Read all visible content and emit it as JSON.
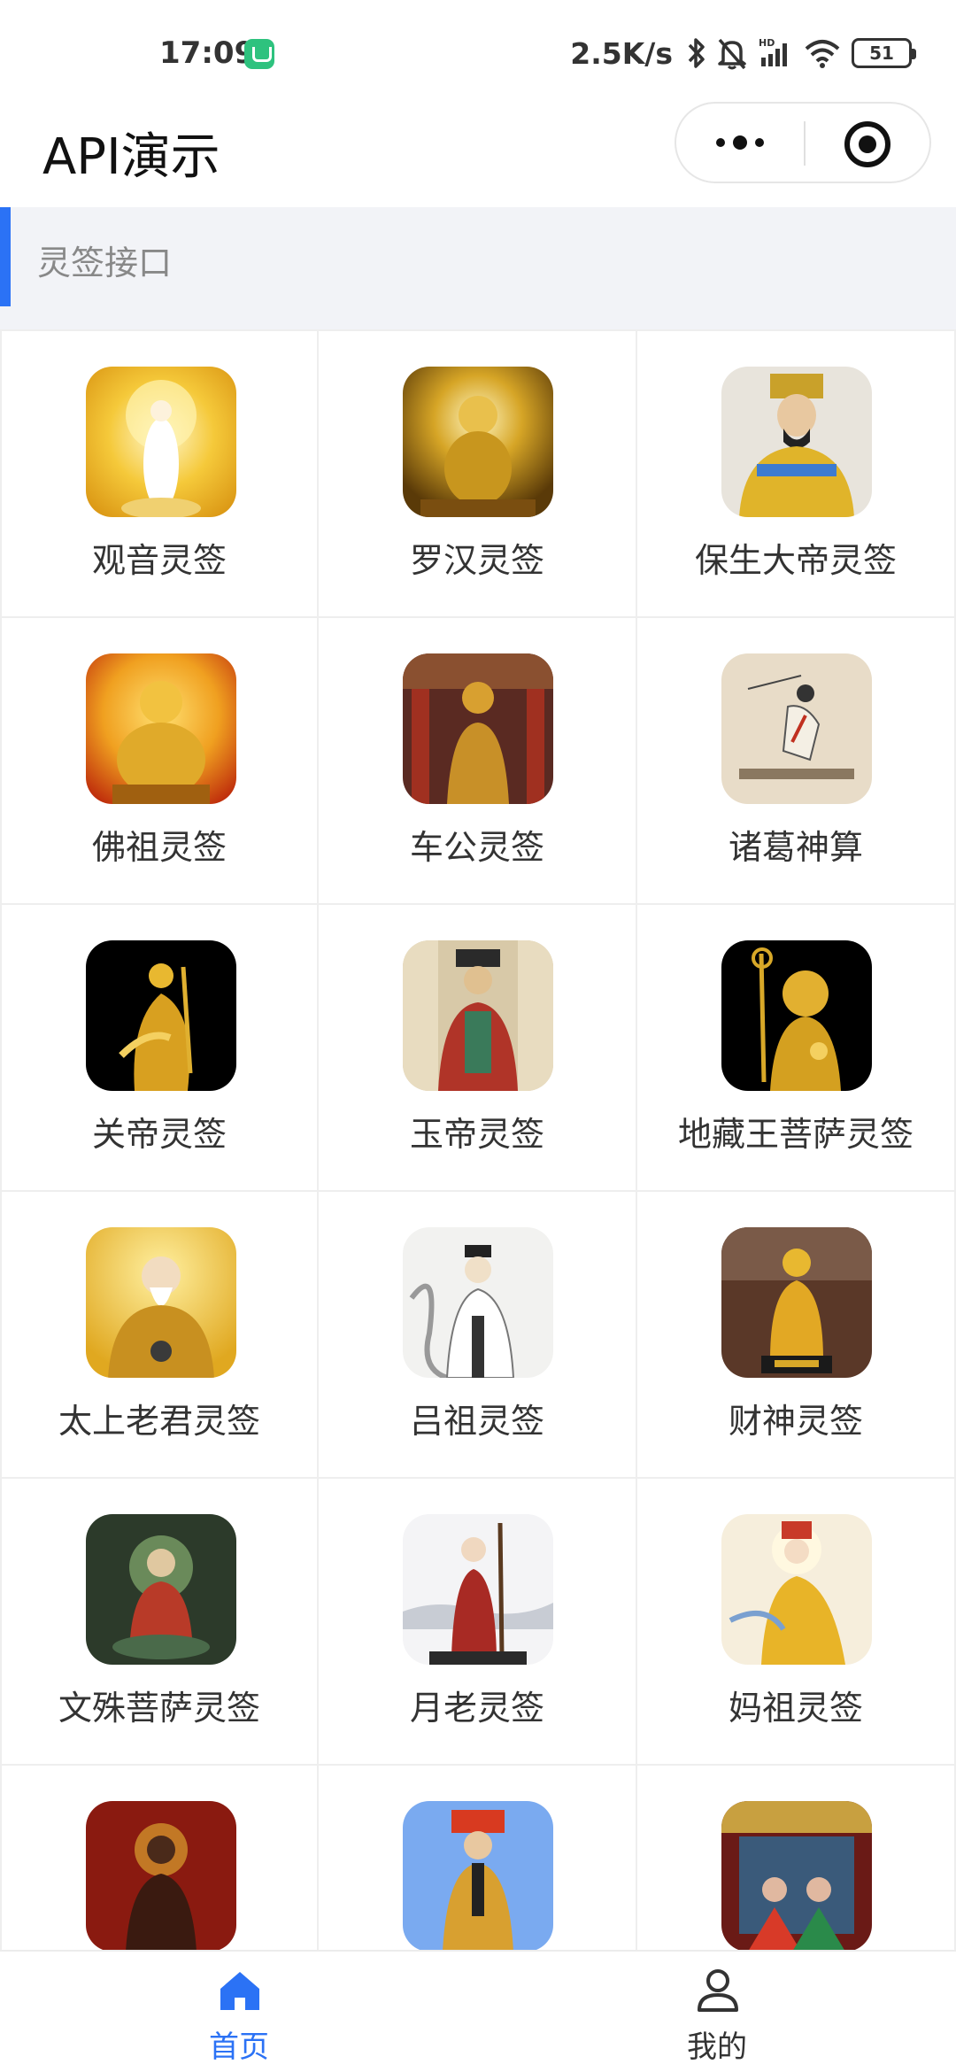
{
  "status_bar": {
    "time": "17:09",
    "network_speed": "2.5K/s",
    "battery": "51",
    "icons": [
      "app-badge-icon",
      "bluetooth-icon",
      "mute-bell-icon",
      "hd-signal-icon",
      "wifi-icon",
      "battery-icon"
    ]
  },
  "nav": {
    "title": "API演示",
    "icons": [
      "more-dots-icon",
      "close-target-icon"
    ]
  },
  "section": {
    "title": "灵签接口",
    "accent_color": "#2b72f5"
  },
  "grid_items": [
    {
      "label": "观音灵签",
      "image": "guanyin-image"
    },
    {
      "label": "罗汉灵签",
      "image": "luohan-image"
    },
    {
      "label": "保生大帝灵签",
      "image": "baosheng-dadi-image"
    },
    {
      "label": "佛祖灵签",
      "image": "fozu-image"
    },
    {
      "label": "车公灵签",
      "image": "chegong-image"
    },
    {
      "label": "诸葛神算",
      "image": "zhuge-image"
    },
    {
      "label": "关帝灵签",
      "image": "guandi-image"
    },
    {
      "label": "玉帝灵签",
      "image": "yudi-image"
    },
    {
      "label": "地藏王菩萨灵签",
      "image": "dizang-image"
    },
    {
      "label": "太上老君灵签",
      "image": "laojun-image"
    },
    {
      "label": "吕祖灵签",
      "image": "lvzu-image"
    },
    {
      "label": "财神灵签",
      "image": "caishen-image"
    },
    {
      "label": "文殊菩萨灵签",
      "image": "wenshu-image"
    },
    {
      "label": "月老灵签",
      "image": "yuelao-image"
    },
    {
      "label": "妈祖灵签",
      "image": "mazu-image"
    },
    {
      "label": "",
      "image": "deity-image-16"
    },
    {
      "label": "",
      "image": "deity-image-17"
    },
    {
      "label": "",
      "image": "deity-image-18"
    }
  ],
  "tab_bar": {
    "home_label": "首页",
    "me_label": "我的",
    "active_color": "#2b72f5",
    "icons": [
      "home-icon",
      "user-icon"
    ]
  }
}
